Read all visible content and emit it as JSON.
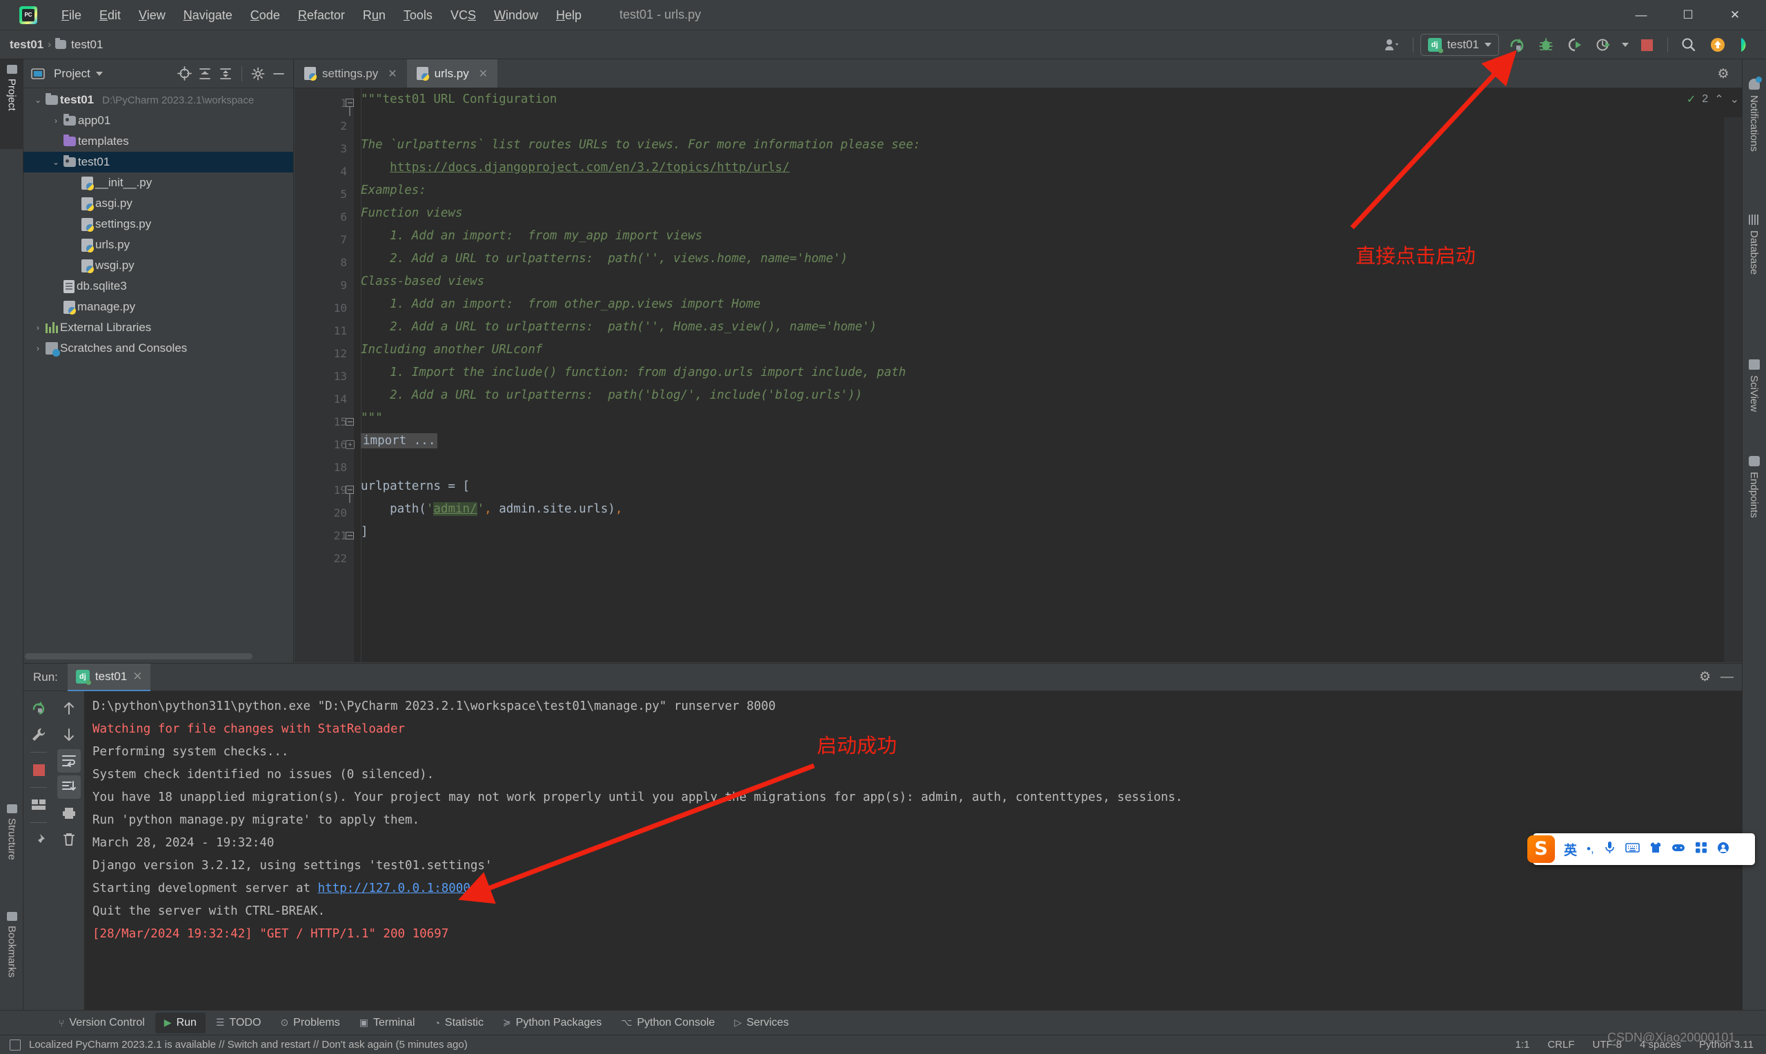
{
  "window": {
    "title": "test01 - urls.py",
    "minimize": "—",
    "maximize": "☐",
    "close": "✕"
  },
  "menu": [
    {
      "label": "File"
    },
    {
      "label": "Edit"
    },
    {
      "label": "View"
    },
    {
      "label": "Navigate"
    },
    {
      "label": "Code"
    },
    {
      "label": "Refactor"
    },
    {
      "label": "Run"
    },
    {
      "label": "Tools"
    },
    {
      "label": "VCS"
    },
    {
      "label": "Window"
    },
    {
      "label": "Help"
    }
  ],
  "navbar": {
    "breadcrumb": [
      "test01",
      "test01"
    ],
    "separator": "›",
    "run_config": "test01",
    "dj_badge": "dj",
    "icons": {
      "account": "account-icon",
      "run": "run-icon",
      "debug": "debug-icon",
      "run_coverage": "run-coverage-icon",
      "profile": "profile-icon",
      "stop": "stop-icon",
      "search": "search-icon",
      "update": "update-project-icon",
      "ai": "ai-assistant-icon"
    }
  },
  "left_strip": {
    "project": "Project",
    "structure": "Structure",
    "bookmarks": "Bookmarks"
  },
  "right_strip": {
    "notifications": "Notifications",
    "database": "Database",
    "sciview": "SciView",
    "endpoints": "Endpoints"
  },
  "project_panel": {
    "title": "Project",
    "header_icons": [
      "locate-icon",
      "expand-all-icon",
      "collapse-all-icon",
      "gear-icon",
      "hide-icon"
    ],
    "tree": [
      {
        "label": "test01",
        "path": "D:\\PyCharm 2023.2.1\\workspace",
        "indent": 0,
        "twist": "⌄",
        "icon": "folder",
        "bold": true,
        "selected": false
      },
      {
        "label": "app01",
        "path": "",
        "indent": 1,
        "twist": "›",
        "icon": "folder-src",
        "bold": false,
        "selected": false
      },
      {
        "label": "templates",
        "path": "",
        "indent": 1,
        "twist": "",
        "icon": "folder-template",
        "bold": false,
        "selected": false
      },
      {
        "label": "test01",
        "path": "",
        "indent": 1,
        "twist": "⌄",
        "icon": "folder-src",
        "bold": false,
        "selected": true
      },
      {
        "label": "__init__.py",
        "path": "",
        "indent": 2,
        "twist": "",
        "icon": "python",
        "bold": false,
        "selected": false
      },
      {
        "label": "asgi.py",
        "path": "",
        "indent": 2,
        "twist": "",
        "icon": "python",
        "bold": false,
        "selected": false
      },
      {
        "label": "settings.py",
        "path": "",
        "indent": 2,
        "twist": "",
        "icon": "python",
        "bold": false,
        "selected": false
      },
      {
        "label": "urls.py",
        "path": "",
        "indent": 2,
        "twist": "",
        "icon": "python",
        "bold": false,
        "selected": false
      },
      {
        "label": "wsgi.py",
        "path": "",
        "indent": 2,
        "twist": "",
        "icon": "python",
        "bold": false,
        "selected": false
      },
      {
        "label": "db.sqlite3",
        "path": "",
        "indent": 1,
        "twist": "",
        "icon": "db",
        "bold": false,
        "selected": false
      },
      {
        "label": "manage.py",
        "path": "",
        "indent": 1,
        "twist": "",
        "icon": "python",
        "bold": false,
        "selected": false
      },
      {
        "label": "External Libraries",
        "path": "",
        "indent": 0,
        "twist": "›",
        "icon": "library",
        "bold": false,
        "selected": false
      },
      {
        "label": "Scratches and Consoles",
        "path": "",
        "indent": 0,
        "twist": "›",
        "icon": "scratch",
        "bold": false,
        "selected": false
      }
    ]
  },
  "editor": {
    "tabs": [
      {
        "label": "settings.py",
        "active": false,
        "close": "✕"
      },
      {
        "label": "urls.py",
        "active": true,
        "close": "✕"
      }
    ],
    "gear": "⚙",
    "inspection_count": "2",
    "inspection_ok": "✓",
    "chevron_up": "⌃",
    "chevron_down": "⌄",
    "code_lines": [
      {
        "n": "1",
        "fold": "minus-top",
        "text": "\"\"\"test01 URL Configuration",
        "style": "doc"
      },
      {
        "n": "2",
        "fold": "",
        "text": "",
        "style": "doc"
      },
      {
        "n": "3",
        "fold": "",
        "text": "The `urlpatterns` list routes URLs to views. For more information please see:",
        "style": "docit"
      },
      {
        "n": "4",
        "fold": "",
        "text": "    https://docs.djangoproject.com/en/3.2/topics/http/urls/",
        "style": "link"
      },
      {
        "n": "5",
        "fold": "",
        "text": "Examples:",
        "style": "docit"
      },
      {
        "n": "6",
        "fold": "",
        "text": "Function views",
        "style": "docit"
      },
      {
        "n": "7",
        "fold": "",
        "text": "    1. Add an import:  from my_app import views",
        "style": "docit"
      },
      {
        "n": "8",
        "fold": "",
        "text": "    2. Add a URL to urlpatterns:  path('', views.home, name='home')",
        "style": "docit"
      },
      {
        "n": "9",
        "fold": "",
        "text": "Class-based views",
        "style": "docit"
      },
      {
        "n": "10",
        "fold": "",
        "text": "    1. Add an import:  from other_app.views import Home",
        "style": "docit"
      },
      {
        "n": "11",
        "fold": "",
        "text": "    2. Add a URL to urlpatterns:  path('', Home.as_view(), name='home')",
        "style": "docit"
      },
      {
        "n": "12",
        "fold": "",
        "text": "Including another URLconf",
        "style": "docit"
      },
      {
        "n": "13",
        "fold": "",
        "text": "    1. Import the include() function: from django.urls import include, path",
        "style": "docit"
      },
      {
        "n": "14",
        "fold": "",
        "text": "    2. Add a URL to urlpatterns:  path('blog/', include('blog.urls'))",
        "style": "docit"
      },
      {
        "n": "15",
        "fold": "minus-bot",
        "text": "\"\"\"",
        "style": "doc"
      },
      {
        "n": "16",
        "fold": "plus",
        "text": "import ...",
        "style": "folded"
      },
      {
        "n": "18",
        "fold": "",
        "text": "",
        "style": "code"
      },
      {
        "n": "19",
        "fold": "minus-top",
        "text": "urlpatterns = [",
        "style": "code"
      },
      {
        "n": "20",
        "fold": "",
        "text": "    path('admin/', admin.site.urls),",
        "style": "code-admin"
      },
      {
        "n": "21",
        "fold": "minus-bot",
        "text": "]",
        "style": "code"
      },
      {
        "n": "22",
        "fold": "",
        "text": "",
        "style": "code"
      }
    ]
  },
  "run_panel": {
    "label": "Run:",
    "tab": "test01",
    "tab_close": "✕",
    "dj_badge": "dj",
    "gear": "⚙",
    "hide": "—",
    "toolbar_left": [
      "rerun-icon",
      "wrench-icon",
      "stop-icon",
      "layout-icon",
      "pin-icon"
    ],
    "toolbar_right": [
      "up-arrow-icon",
      "down-arrow-icon",
      "soft-wrap-icon",
      "scroll-to-end-icon",
      "print-icon",
      "trash-icon"
    ],
    "console": [
      {
        "text": "D:\\python\\python311\\python.exe \"D:\\PyCharm 2023.2.1\\workspace\\test01\\manage.py\" runserver 8000",
        "style": "norm"
      },
      {
        "text": "Watching for file changes with StatReloader",
        "style": "err"
      },
      {
        "text": "Performing system checks...",
        "style": "norm"
      },
      {
        "text": "",
        "style": "norm"
      },
      {
        "text": "System check identified no issues (0 silenced).",
        "style": "norm"
      },
      {
        "text": "",
        "style": "norm"
      },
      {
        "text": "You have 18 unapplied migration(s). Your project may not work properly until you apply the migrations for app(s): admin, auth, contenttypes, sessions.",
        "style": "norm"
      },
      {
        "text": "Run 'python manage.py migrate' to apply them.",
        "style": "norm"
      },
      {
        "text": "March 28, 2024 - 19:32:40",
        "style": "norm"
      },
      {
        "text": "Django version 3.2.12, using settings 'test01.settings'",
        "style": "norm"
      },
      {
        "text": "Starting development server at ",
        "style": "norm",
        "link": "http://127.0.0.1:8000/"
      },
      {
        "text": "Quit the server with CTRL-BREAK.",
        "style": "norm"
      },
      {
        "text": "[28/Mar/2024 19:32:42] \"GET / HTTP/1.1\" 200 10697",
        "style": "err"
      }
    ]
  },
  "bottom_bar": [
    {
      "label": "Version Control",
      "icon": "branch-icon",
      "active": false
    },
    {
      "label": "Run",
      "icon": "play-icon",
      "active": true
    },
    {
      "label": "TODO",
      "icon": "list-icon",
      "active": false
    },
    {
      "label": "Problems",
      "icon": "warning-icon",
      "active": false
    },
    {
      "label": "Terminal",
      "icon": "terminal-icon",
      "active": false
    },
    {
      "label": "Statistic",
      "icon": "chart-icon",
      "active": false
    },
    {
      "label": "Python Packages",
      "icon": "package-icon",
      "active": false
    },
    {
      "label": "Python Console",
      "icon": "python-icon",
      "active": false
    },
    {
      "label": "Services",
      "icon": "services-icon",
      "active": false
    }
  ],
  "status_bar": {
    "message": "Localized PyCharm 2023.2.1 is available // Switch and restart // Don't ask again (5 minutes ago)",
    "caret": "1:1",
    "line_sep": "CRLF",
    "encoding": "UTF-8",
    "indent": "4 spaces",
    "interpreter": "Python 3.11"
  },
  "annotations": [
    {
      "text": "直接点击启动",
      "color": "#ee2211"
    },
    {
      "text": "启动成功",
      "color": "#ee2211"
    }
  ],
  "ime": {
    "logo": "S",
    "mode": "英",
    "items": [
      "punctuation-icon",
      "microphone-icon",
      "keyboard-icon",
      "skin-icon",
      "game-icon",
      "apps-icon",
      "account-icon"
    ]
  },
  "watermark": "CSDN@Xiao20000101",
  "colors": {
    "bg": "#3c3f41",
    "editor_bg": "#2b2b2b",
    "accent": "#4a88c7",
    "selection": "#0d293e",
    "comment_green": "#6a8759",
    "error_red": "#ff6b68",
    "annotation_red": "#ee2211",
    "run_green": "#59a869"
  }
}
